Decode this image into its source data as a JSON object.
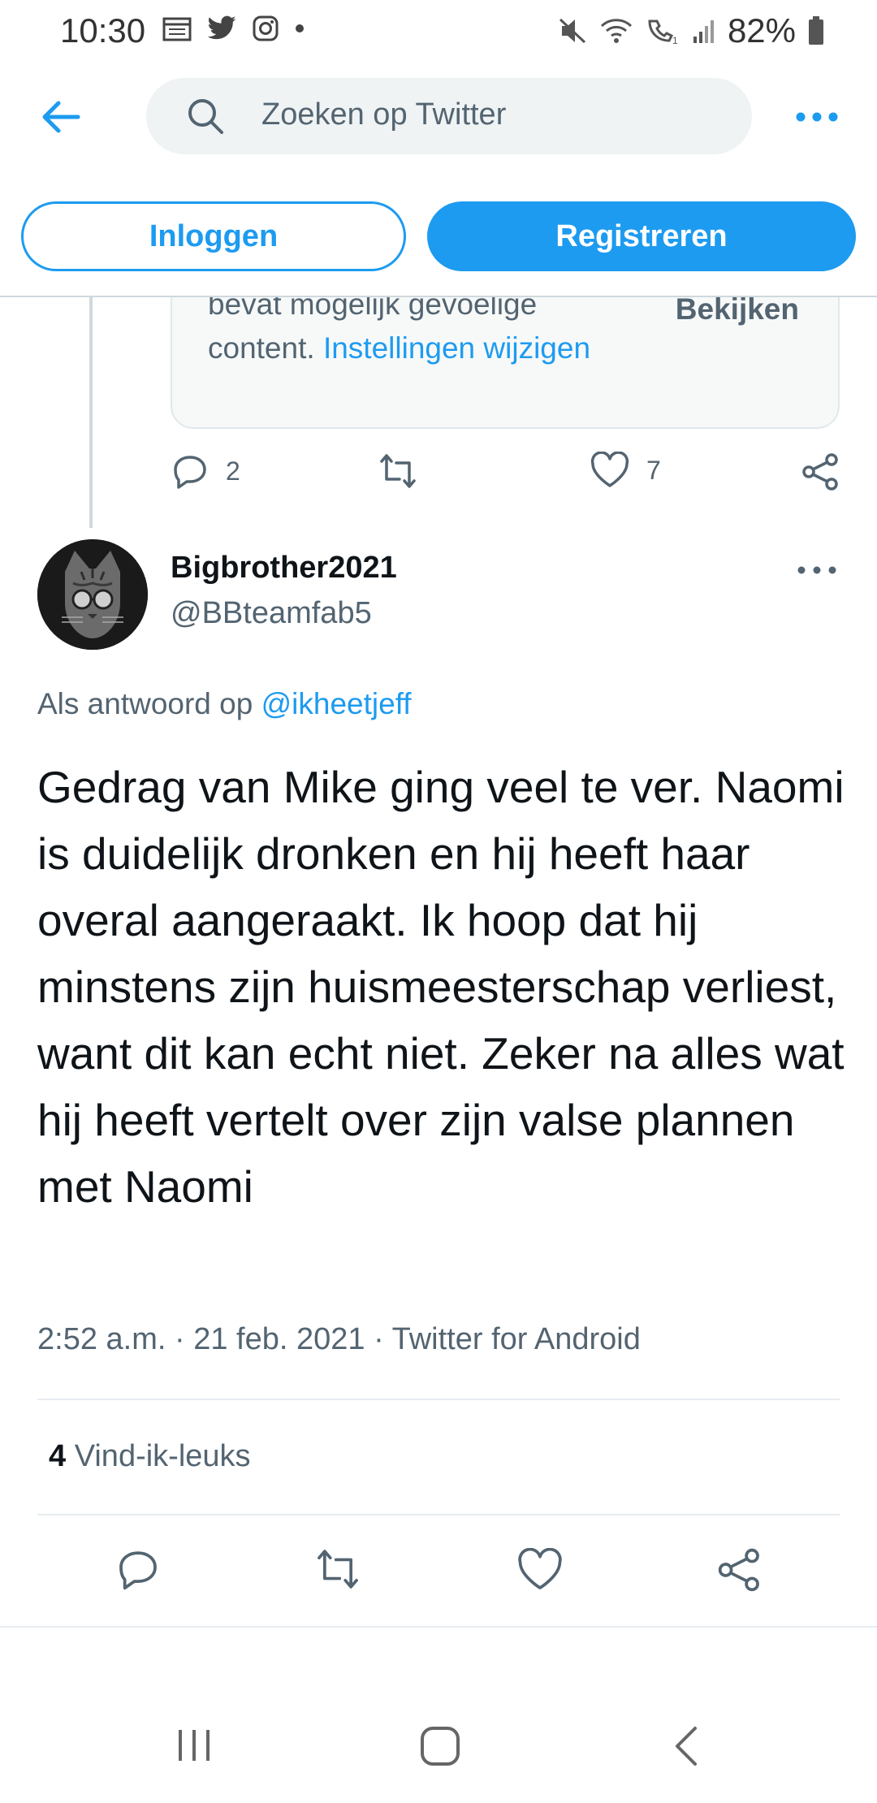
{
  "status_bar": {
    "time": "10:30",
    "battery": "82%"
  },
  "header": {
    "search_placeholder": "Zoeken op Twitter"
  },
  "auth": {
    "login_label": "Inloggen",
    "register_label": "Registreren"
  },
  "previous_tweet": {
    "sensitive_text_cut": "bevat mogelijk gevoelige",
    "sensitive_text": "content.",
    "settings_link": "Instellingen wijzigen",
    "view_label": "Bekijken",
    "reply_count": "2",
    "like_count": "7"
  },
  "tweet": {
    "display_name": "Bigbrother2021",
    "handle": "@BBteamfab5",
    "reply_prefix": "Als antwoord op",
    "reply_mention": "@ikheetjeff",
    "text": "Gedrag van Mike ging veel te ver. Naomi is duidelijk dronken en hij heeft haar overal aangeraakt. Ik hoop dat hij minstens zijn huismeesterschap verliest, want dit kan echt niet. Zeker na alles wat hij heeft vertelt over zijn valse plannen met Naomi",
    "time": "2:52 a.m.",
    "date": "21 feb. 2021",
    "source": "Twitter for Android",
    "likes_count": "4",
    "likes_label": "Vind-ik-leuks"
  },
  "colors": {
    "accent": "#1d9bf0",
    "secondary_text": "#536471",
    "text": "#0f1419"
  }
}
